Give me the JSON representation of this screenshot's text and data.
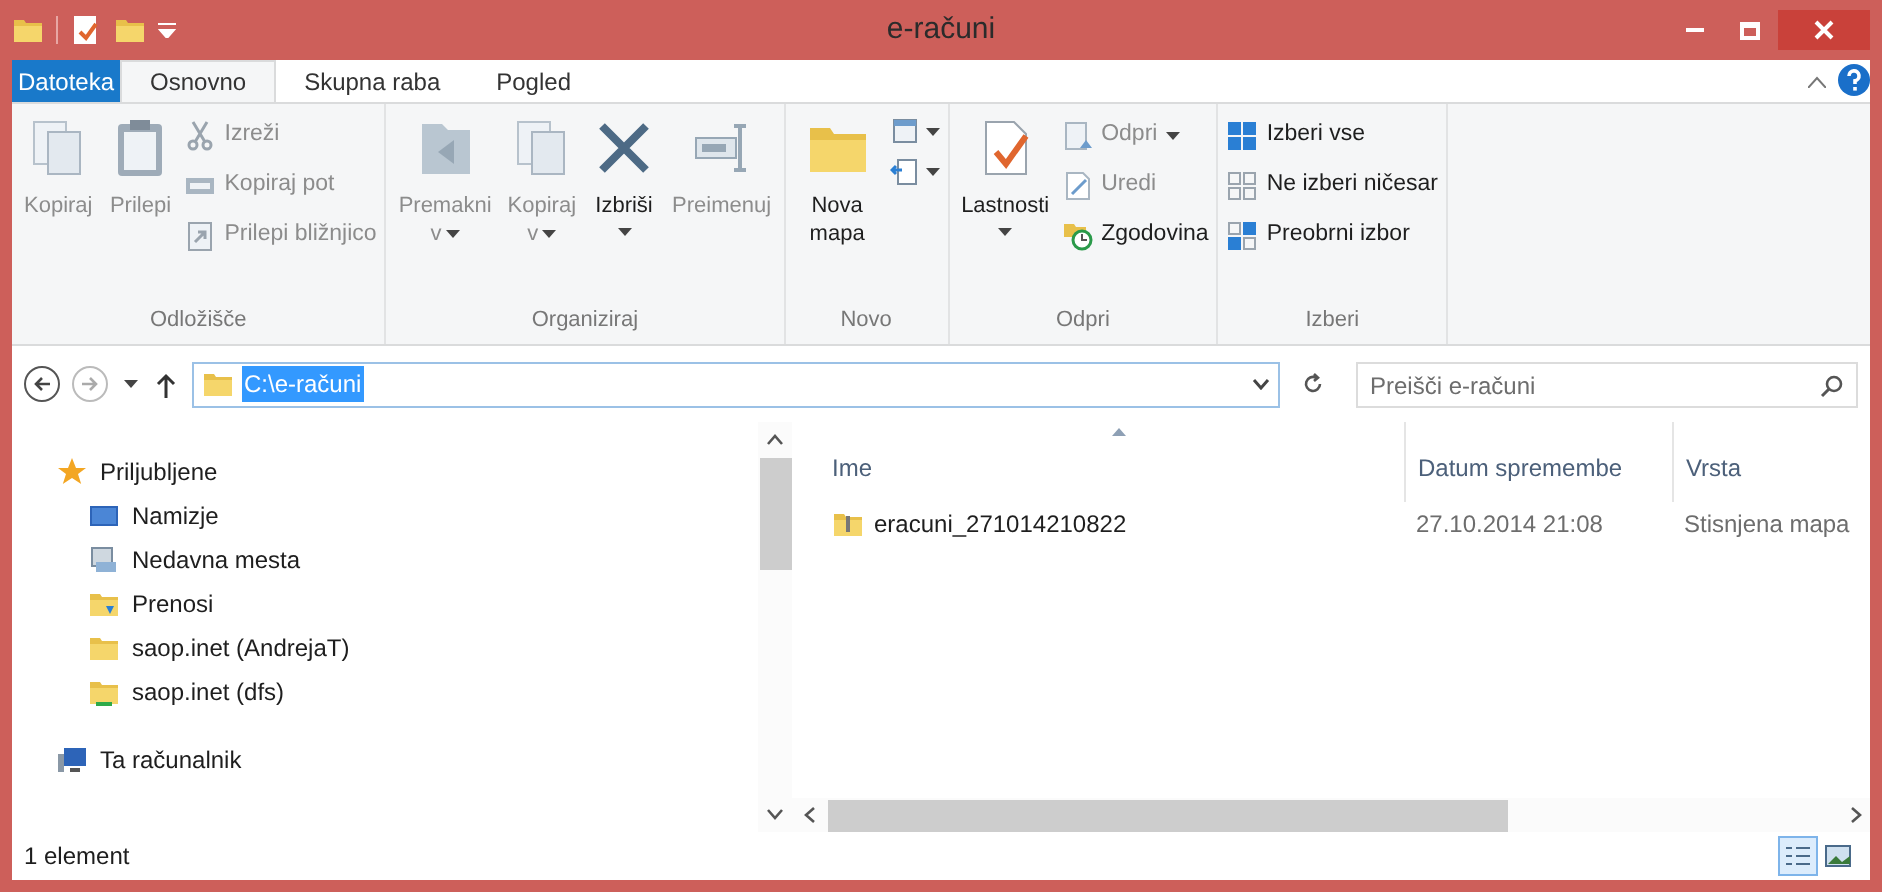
{
  "window": {
    "title": "e-računi"
  },
  "ribbon": {
    "tabs": [
      {
        "label": "Datoteka",
        "kind": "file",
        "selected": false
      },
      {
        "label": "Osnovno",
        "kind": "tab",
        "selected": true
      },
      {
        "label": "Skupna raba",
        "kind": "tab",
        "selected": false
      },
      {
        "label": "Pogled",
        "kind": "tab",
        "selected": false
      }
    ],
    "groups": [
      {
        "label": "Odložišče",
        "items": [
          {
            "kind": "large",
            "label": "Kopiraj",
            "disabled": true
          },
          {
            "kind": "large",
            "label": "Prilepi",
            "disabled": true
          },
          {
            "kind": "stack",
            "children": [
              {
                "label": "Izreži",
                "disabled": true
              },
              {
                "label": "Kopiraj pot",
                "disabled": true
              },
              {
                "label": "Prilepi bližnjico",
                "disabled": true
              }
            ]
          }
        ]
      },
      {
        "label": "Organiziraj",
        "items": [
          {
            "kind": "large",
            "label": "Premakni",
            "sub": "v",
            "disabled": true
          },
          {
            "kind": "large",
            "label": "Kopiraj",
            "sub": "v",
            "disabled": true
          },
          {
            "kind": "large",
            "label": "Izbriši",
            "caret": true,
            "disabled": false
          },
          {
            "kind": "large",
            "label": "Preimenuj",
            "disabled": true
          }
        ]
      },
      {
        "label": "Novo",
        "items": [
          {
            "kind": "large",
            "label": "Nova mapa",
            "disabled": false
          },
          {
            "kind": "iconstack"
          }
        ]
      },
      {
        "label": "Odpri",
        "items": [
          {
            "kind": "large",
            "label": "Lastnosti",
            "caret": true,
            "disabled": false
          },
          {
            "kind": "stack",
            "children": [
              {
                "label": "Odpri",
                "disabled": true,
                "caret": true
              },
              {
                "label": "Uredi",
                "disabled": true
              },
              {
                "label": "Zgodovina",
                "disabled": false
              }
            ]
          }
        ]
      },
      {
        "label": "Izberi",
        "items": [
          {
            "kind": "stack",
            "children": [
              {
                "label": "Izberi vse",
                "disabled": false
              },
              {
                "label": "Ne izberi ničesar",
                "disabled": false
              },
              {
                "label": "Preobrni izbor",
                "disabled": false
              }
            ]
          }
        ]
      }
    ]
  },
  "address": {
    "path": "C:\\e-računi",
    "selected": true
  },
  "search": {
    "placeholder": "Preišči e-računi"
  },
  "navigation": [
    {
      "label": "Priljubljene",
      "children": [
        {
          "label": "Namizje"
        },
        {
          "label": "Nedavna mesta"
        },
        {
          "label": "Prenosi"
        },
        {
          "label": "saop.inet (AndrejaT)"
        },
        {
          "label": "saop.inet (dfs)"
        }
      ]
    },
    {
      "label": "Ta računalnik"
    }
  ],
  "table": {
    "columns": [
      "Ime",
      "Datum spremembe",
      "Vrsta"
    ],
    "rows": [
      {
        "cells": [
          "eracuni_271014210822",
          "27.10.2014 21:08",
          "Stisnjena mapa"
        ]
      }
    ]
  },
  "status_bar": {
    "text": "1 element",
    "views": [
      {
        "kind": "details",
        "selected": true
      },
      {
        "kind": "icons",
        "selected": false
      }
    ]
  }
}
